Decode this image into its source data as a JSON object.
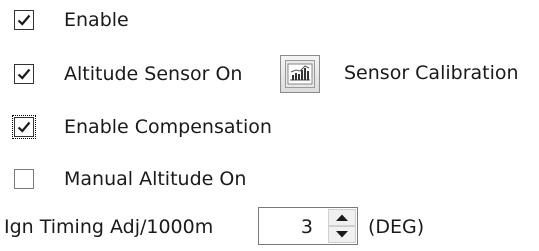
{
  "options": {
    "enable": {
      "label": "Enable",
      "checked": true
    },
    "altitude_sensor": {
      "label": "Altitude Sensor On",
      "checked": true
    },
    "sensor_calibration": {
      "label": "Sensor Calibration",
      "icon": "graph-calibration-icon"
    },
    "enable_compensation": {
      "label": "Enable Compensation",
      "checked": true,
      "focused": true
    },
    "manual_altitude": {
      "label": "Manual Altitude On",
      "checked": false
    }
  },
  "ign_timing": {
    "label": "Ign Timing Adj/1000m",
    "value": "3",
    "unit": "(DEG)"
  }
}
